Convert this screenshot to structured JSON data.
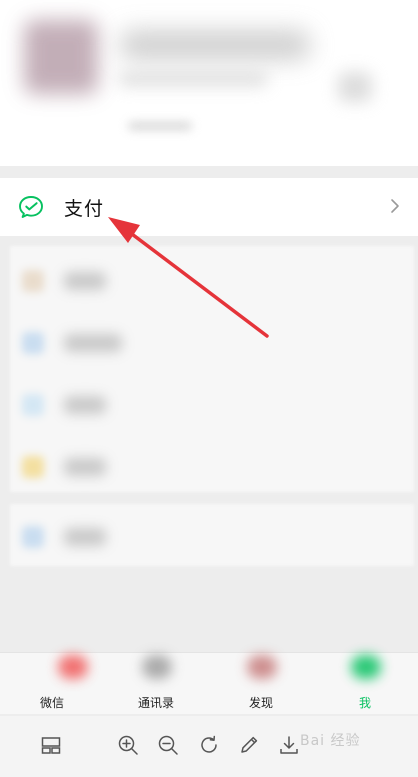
{
  "pay": {
    "label": "支付"
  },
  "tabbar": {
    "tabs": [
      {
        "label": "微信",
        "active": false
      },
      {
        "label": "通讯录",
        "active": false
      },
      {
        "label": "发现",
        "active": false
      },
      {
        "label": "我",
        "active": true
      }
    ]
  },
  "toolbar": {
    "buttons": [
      "layout-icon",
      "zoom-in-icon",
      "zoom-out-icon",
      "rotate-icon",
      "edit-icon",
      "download-icon"
    ],
    "watermark": "Bai 经验"
  },
  "colors": {
    "accent": "#07c160",
    "arrow": "#e5343a",
    "background": "#ededed"
  }
}
